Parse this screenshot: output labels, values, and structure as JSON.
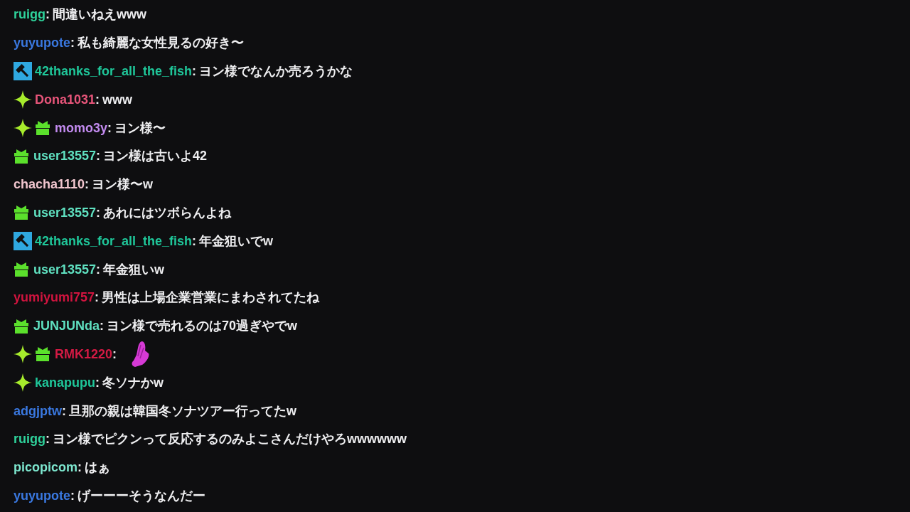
{
  "chat": {
    "messages": [
      {
        "kind": "text",
        "user": "ruigg",
        "color": "#2fd39c",
        "separator": ":",
        "text": "間違いねえwww"
      },
      {
        "kind": "text",
        "user": "yuyupote",
        "color": "#3a78e0",
        "separator": ":",
        "text": "私も綺麗な女性見るの好き〜"
      },
      {
        "kind": "text",
        "user": "42thanks_for_all_the_fish",
        "color": "#1fc79a",
        "badges": [
          {
            "kind": "mod"
          }
        ],
        "separator": ":",
        "text": "ヨン様でなんか売ろうかな"
      },
      {
        "kind": "text",
        "user": "Dona1031",
        "color": "#e8557a",
        "badges": [
          {
            "kind": "sparkle"
          }
        ],
        "separator": ":",
        "text": "www"
      },
      {
        "kind": "text",
        "user": "momo3y",
        "color": "#c38bf0",
        "badges": [
          {
            "kind": "sparkle"
          },
          {
            "kind": "gift"
          }
        ],
        "separator": ":",
        "text": "ヨン様〜"
      },
      {
        "kind": "text",
        "user": "user13557",
        "color": "#5fe0c0",
        "badges": [
          {
            "kind": "gift"
          }
        ],
        "separator": ":",
        "text": "ヨン様は古いよ42"
      },
      {
        "kind": "text",
        "user": "chacha1110",
        "color": "#f2c6cf",
        "separator": ":",
        "text": "ヨン様〜w"
      },
      {
        "kind": "text",
        "user": "user13557",
        "color": "#5fe0c0",
        "badges": [
          {
            "kind": "gift"
          }
        ],
        "separator": ":",
        "text": "あれにはツボらんよね"
      },
      {
        "kind": "text",
        "user": "42thanks_for_all_the_fish",
        "color": "#1fc79a",
        "badges": [
          {
            "kind": "mod"
          }
        ],
        "separator": ":",
        "text": "年金狙いでw"
      },
      {
        "kind": "text",
        "user": "user13557",
        "color": "#5fe0c0",
        "badges": [
          {
            "kind": "gift"
          }
        ],
        "separator": ":",
        "text": "年金狙いw"
      },
      {
        "kind": "text",
        "user": "yumiyumi757",
        "color": "#d2143f",
        "separator": ":",
        "text": "男性は上場企業営業にまわされてたね"
      },
      {
        "kind": "text",
        "user": "JUNJUNda",
        "color": "#5fe0c0",
        "badges": [
          {
            "kind": "gift"
          }
        ],
        "separator": ":",
        "text": "ヨン様で売れるのは70過ぎやでw"
      },
      {
        "kind": "emote",
        "user": "RMK1220",
        "color": "#d41a44",
        "badges": [
          {
            "kind": "sparkle"
          },
          {
            "kind": "gift"
          }
        ],
        "separator": ":"
      },
      {
        "kind": "text",
        "user": "kanapupu",
        "color": "#1fc79a",
        "badges": [
          {
            "kind": "sparkle"
          }
        ],
        "separator": ":",
        "text": "冬ソナかw"
      },
      {
        "kind": "text",
        "user": "adgjptw",
        "color": "#3a78e0",
        "separator": ":",
        "text": "旦那の親は韓国冬ソナツアー行ってたw"
      },
      {
        "kind": "text",
        "user": "ruigg",
        "color": "#2fd39c",
        "separator": ":",
        "text": "ヨン様でピクンって反応するのみよこさんだけやろwwwwww"
      },
      {
        "kind": "text",
        "user": "picopicom",
        "color": "#7ee8d0",
        "separator": ":",
        "text": "はぁ"
      },
      {
        "kind": "text",
        "user": "yuyupote",
        "color": "#3a78e0",
        "separator": ":",
        "text": "げーーーそうなんだー"
      }
    ]
  }
}
